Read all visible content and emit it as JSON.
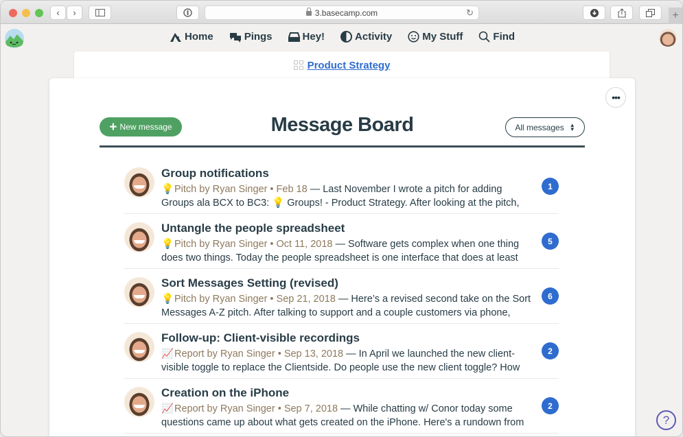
{
  "browser": {
    "url": "3.basecamp.com",
    "new_tab_label": "+"
  },
  "nav": {
    "items": [
      {
        "label": "Home",
        "icon": "home-icon"
      },
      {
        "label": "Pings",
        "icon": "pings-icon"
      },
      {
        "label": "Hey!",
        "icon": "inbox-icon"
      },
      {
        "label": "Activity",
        "icon": "activity-icon"
      },
      {
        "label": "My Stuff",
        "icon": "smiley-icon"
      },
      {
        "label": "Find",
        "icon": "search-icon"
      }
    ]
  },
  "breadcrumb": {
    "project": "Product Strategy"
  },
  "board": {
    "title": "Message Board",
    "new_button": "New message",
    "new_button_icon": "+",
    "filter_label": "All messages",
    "more_label": "•••"
  },
  "messages": [
    {
      "title": "Group notifications",
      "category_icon": "lightbulb",
      "meta": "Pitch by Ryan Singer • Feb 18",
      "excerpt": " — Last November I wrote a pitch for adding Groups ala BCX to BC3: 💡 Groups! - Product Strategy. After looking at the pitch,",
      "count": "1"
    },
    {
      "title": "Untangle the people spreadsheet",
      "category_icon": "lightbulb",
      "meta": "Pitch by Ryan Singer • Oct 11, 2018",
      "excerpt": " — Software gets complex when one thing does two things. Today the people spreadsheet is one interface that does at least",
      "count": "5"
    },
    {
      "title": "Sort Messages Setting (revised)",
      "category_icon": "lightbulb",
      "meta": "Pitch by Ryan Singer • Sep 21, 2018",
      "excerpt": " — Here’s a revised second take on the Sort Messages A-Z pitch. After talking to support and a couple customers via phone,",
      "count": "6"
    },
    {
      "title": "Follow-up: Client-visible recordings",
      "category_icon": "chart",
      "meta": "Report by Ryan Singer • Sep 13, 2018",
      "excerpt": " — In April we launched the new client-visible toggle to replace the Clientside. Do people use the new client toggle? How",
      "count": "2"
    },
    {
      "title": "Creation on the iPhone",
      "category_icon": "chart",
      "meta": "Report by Ryan Singer • Sep 7, 2018",
      "excerpt": " — While chatting w/ Conor today some questions came up about what gets created on the iPhone. Here's a rundown from",
      "count": "2"
    }
  ],
  "emoji": {
    "lightbulb": "💡",
    "chart": "📈"
  },
  "help_label": "?",
  "colors": {
    "accent_green": "#4fa163",
    "link_blue": "#2f6ccf",
    "badge_blue": "#2f6ccf",
    "meta_brown": "#8e7a5d",
    "text_dark": "#283c46"
  }
}
